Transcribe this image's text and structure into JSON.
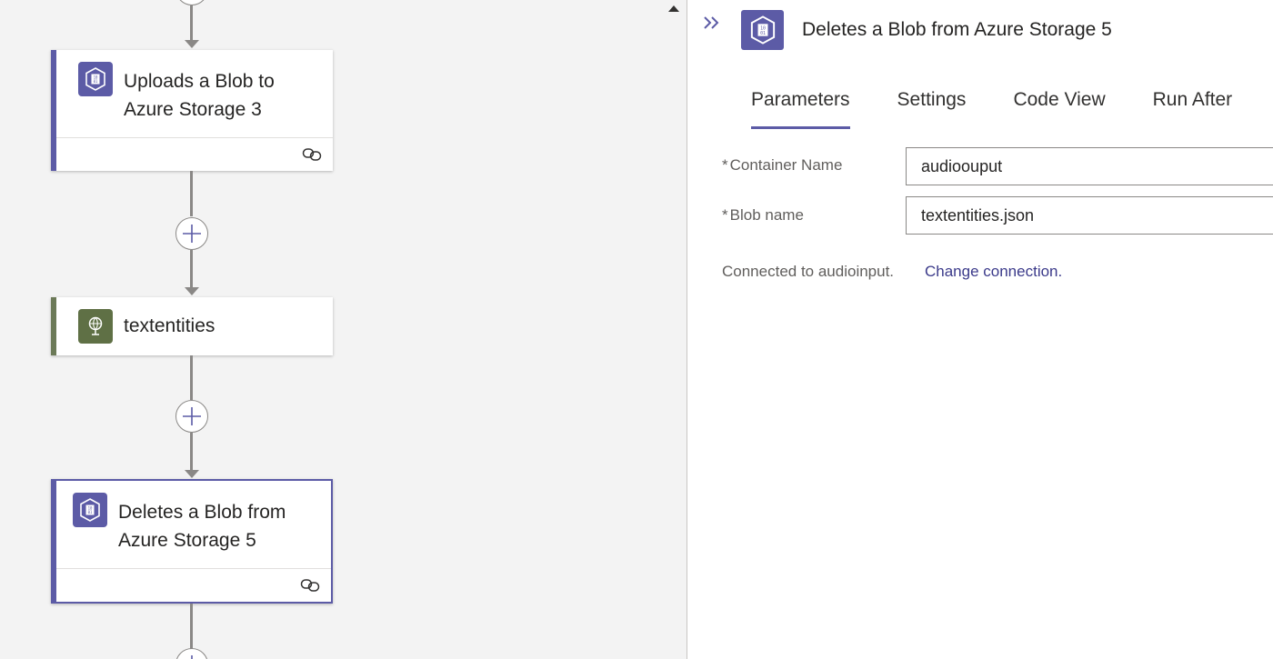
{
  "colors": {
    "accent": "#5c5ba6",
    "variable_icon": "#5f7045",
    "canvas_bg": "#f3f3f3",
    "connector": "#8a8886",
    "link": "#3b3a8a"
  },
  "canvas": {
    "cards": [
      {
        "title": "Uploads a Blob to Azure Storage 3",
        "icon": "azure-blob-storage-icon",
        "footer_icon": "link-icon"
      },
      {
        "title": "textentities",
        "icon": "globe-variable-icon"
      },
      {
        "title": "Deletes a Blob from Azure Storage 5",
        "icon": "azure-blob-storage-icon",
        "footer_icon": "link-icon",
        "selected": true
      }
    ]
  },
  "panel": {
    "title": "Deletes a Blob from Azure Storage 5",
    "collapse_icon": "double-chevron-right-icon",
    "tabs": [
      {
        "label": "Parameters",
        "active": true
      },
      {
        "label": "Settings",
        "active": false
      },
      {
        "label": "Code View",
        "active": false
      },
      {
        "label": "Run After",
        "active": false
      }
    ],
    "fields": [
      {
        "required_mark": "*",
        "label": "Container Name",
        "value": "audioouput"
      },
      {
        "required_mark": "*",
        "label": "Blob name",
        "value": "textentities.json"
      }
    ],
    "connection_text": "Connected to audioinput.",
    "change_connection": "Change connection."
  }
}
